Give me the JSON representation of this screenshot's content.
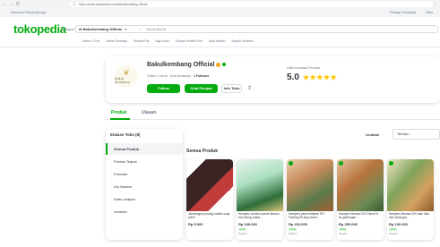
{
  "browser": {
    "back": "←",
    "forward": "→",
    "reload": "C",
    "lock": "ⓘ",
    "url": "https://www.tokopedia.com/bakulkembang-official",
    "menu": "⋮"
  },
  "topstrip": {
    "left": "Download Tokopedia App",
    "right_items": [
      "Tentang Tokopedia",
      "Mitra"
    ]
  },
  "header": {
    "logo": "tokopedia",
    "category_link": "Kategori",
    "search_scope": "di Bakulkembang Official",
    "search_placeholder": "Cari di toko ini",
    "keywords": [
      "Sabun 2 Pcs",
      "Sweet Sunnday",
      "Sendal Pria",
      "Baju Kaos",
      "Celana Pendek Pria",
      "Baju Muslim",
      "Sepatu Snekers",
      "Tas Wanita",
      "Totebag"
    ]
  },
  "shop": {
    "logo_text": "Bakul Kembang",
    "name": "Bakulkembang Official",
    "meta_status": "Online 1 menit",
    "meta_location": "Kota Surabaya",
    "meta_followers": "1 Follower",
    "follow_label": "Follow",
    "chat_label": "Chat Penjual",
    "info_label": "Info Toko",
    "rating_label": "Nilai Kualitas Produk",
    "rating_score": "5.0",
    "rating_stars": "★★★★★"
  },
  "tabs": {
    "items": [
      "Produk",
      "Ulasan"
    ],
    "active": "Produk"
  },
  "etalase": {
    "title": "Etalase Toko (8)",
    "items": [
      "Semua Produk",
      "Produk Terjual",
      "Preorder",
      "Dry flowers",
      "Kartu ucapan",
      "Lebaran"
    ],
    "active_index": 0
  },
  "sort": {
    "label": "Urutkan",
    "value": "Terbaru"
  },
  "products_section_title": "Semua Produk",
  "products": [
    {
      "name": "Jambangan pouring bubble wrap pelek",
      "price": "Rp 5.000",
      "tag": "",
      "loc": "",
      "color_a": "#4a2c2a",
      "color_b": "#c23b3b"
    },
    {
      "name": "Hampers cookies parcel lebaran box kering coklat...",
      "price": "Rp 189.000",
      "tag": "Grosir",
      "loc": "Terjual 1",
      "color_a": "#aee0c2",
      "color_b": "#2e6e3a"
    },
    {
      "name": "Hampers parcel lebaran DIY Packing Kit kayu dried...",
      "price": "Rp 202.000",
      "tag": "Grosir",
      "loc": "Terjual 1",
      "color_a": "#c98c5e",
      "color_b": "#5a7a4a"
    },
    {
      "name": "Hampers lebaran DIY Parcel hr kit gantungan ...",
      "price": "Rp 250.000",
      "tag": "Grosir",
      "loc": "Terjual 1",
      "color_a": "#b8743f",
      "color_b": "#6c8a54"
    },
    {
      "name": "Hampers lebaran DIY isian hias mini lantai gar...",
      "price": "Rp 150.000",
      "tag": "Grosir",
      "loc": "Terjual 1",
      "color_a": "#7fa35a",
      "color_b": "#d4a160"
    }
  ]
}
